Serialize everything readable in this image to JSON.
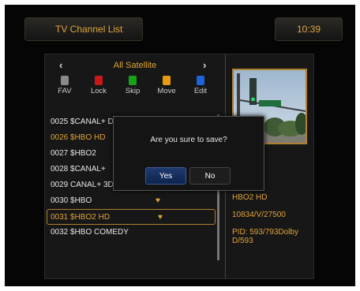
{
  "header": {
    "title": "TV Channel List",
    "clock": "10:39"
  },
  "satellite": {
    "name": "All Satellite"
  },
  "color_keys": [
    {
      "label": "FAV",
      "color": "#8a8a8a"
    },
    {
      "label": "Lock",
      "color": "#c81818"
    },
    {
      "label": "Skip",
      "color": "#17a318"
    },
    {
      "label": "Move",
      "color": "#e89a10"
    },
    {
      "label": "Edit",
      "color": "#1f63d8"
    }
  ],
  "channels": [
    {
      "text": "0025 $CANAL+ DECALE",
      "fav": false
    },
    {
      "text": "0026 $HBO HD",
      "fav": false
    },
    {
      "text": "0027 $HBO2",
      "fav": false
    },
    {
      "text": "0028 $CANAL+",
      "fav": false
    },
    {
      "text": "0029 CANAL+ 3D",
      "fav": false
    },
    {
      "text": "0030 $HBO",
      "fav": true
    },
    {
      "text": "0031 $HBO2 HD",
      "fav": true
    },
    {
      "text": "0032 $HBO COMEDY",
      "fav": false
    }
  ],
  "info": {
    "name": "HBO2 HD",
    "frequency": "10834/V/27500",
    "pid": "PID: 593/793Dolby D/593"
  },
  "dialog": {
    "message": "Are you sure to save?",
    "yes": "Yes",
    "no": "No"
  },
  "accent": "#e0a43a"
}
